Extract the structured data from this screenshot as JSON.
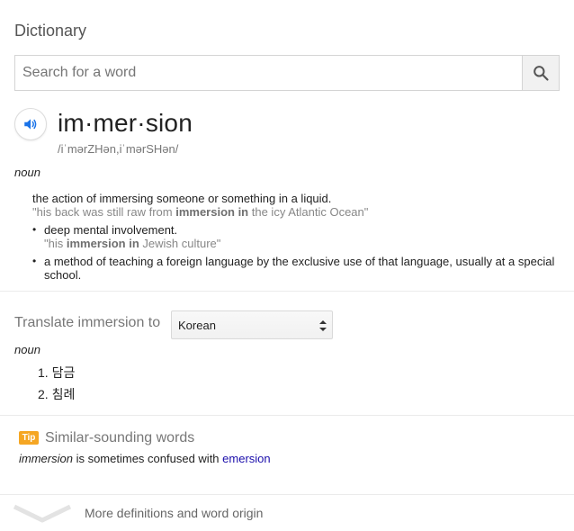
{
  "panel": {
    "title": "Dictionary"
  },
  "search": {
    "placeholder": "Search for a word",
    "value": ""
  },
  "entry": {
    "headword": "im·mer·sion",
    "phonetic": "/iˈmərZHən,iˈmərSHən/",
    "part_of_speech": "noun",
    "definitions": [
      {
        "text": "the action of immersing someone or something in a liquid.",
        "example_pre": "\"his back was still raw from ",
        "example_bold": "immersion in",
        "example_post": " the icy Atlantic Ocean\""
      },
      {
        "text": "deep mental involvement.",
        "example_pre": "\"his ",
        "example_bold": "immersion in",
        "example_post": " Jewish culture\""
      },
      {
        "text": "a method of teaching a foreign language by the exclusive use of that language, usually at a special school."
      }
    ]
  },
  "translate": {
    "label": "Translate immersion to",
    "selected_language": "Korean",
    "part_of_speech": "noun",
    "items": [
      "1. 담금",
      "2. 침례"
    ]
  },
  "tip": {
    "badge": "Tip",
    "title": "Similar-sounding words",
    "word": "immersion",
    "text": " is sometimes confused with ",
    "link": "emersion"
  },
  "footer": {
    "more_label": "More definitions and word origin"
  },
  "colors": {
    "link": "#1a0dab",
    "tip_badge": "#f5a623",
    "speaker_icon": "#1a73e8"
  }
}
